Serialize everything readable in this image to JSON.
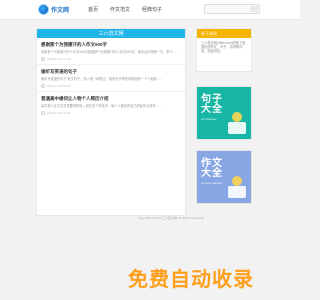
{
  "site": {
    "logo_text": "作文网"
  },
  "nav": {
    "items": [
      "首页",
      "作文范文",
      "经典句子"
    ]
  },
  "main": {
    "header": "三六范文网",
    "articles": [
      {
        "title": "感谢那个为我擦汗的人作文600字",
        "excerpt": "感谢那个为我擦汗的人作文600字感谢那个为我擦汗的人作文600字，我永远记得那一天，那个……",
        "meta": "2024-01-05 17:46"
      },
      {
        "title": "偷听写英语的句子",
        "excerpt": "偷听写英语的句子  英文句子，是人类一种表达，英语句子有的时候如同一个个画面……",
        "meta": "2024-01-06 09:32"
      },
      {
        "title": "普通高中缘何让人物个人简历介绍",
        "excerpt": "高中是人生中至关重要的阶段，而在这个阶段中，每个人都会有自己的经历与故事……",
        "meta": "2024-01-06 14:11"
      }
    ]
  },
  "footer": {
    "text": "Copyright © 2024 三六范文网 All Rights Reserved"
  },
  "side": {
    "header": "关于本网",
    "text": "三六范文网(36fw.com)收集了各类优质作文、句子、诗词等内容，欢迎浏览。"
  },
  "promos": [
    {
      "title": "句子\n大全",
      "sub": "juzi daquan"
    },
    {
      "title": "作文\n大全",
      "sub": "zuowen daquan"
    }
  ],
  "watermark": {
    "text": "免费自动收录"
  },
  "colors": {
    "header": "#1fb5e9",
    "side_header": "#f4b400",
    "promo1": "#18b6a5",
    "promo2": "#86a7e4",
    "watermark": "#ff9f1c"
  },
  "icons": {
    "logo": "logo-icon",
    "search": "search-icon",
    "clock": "clock-icon"
  }
}
